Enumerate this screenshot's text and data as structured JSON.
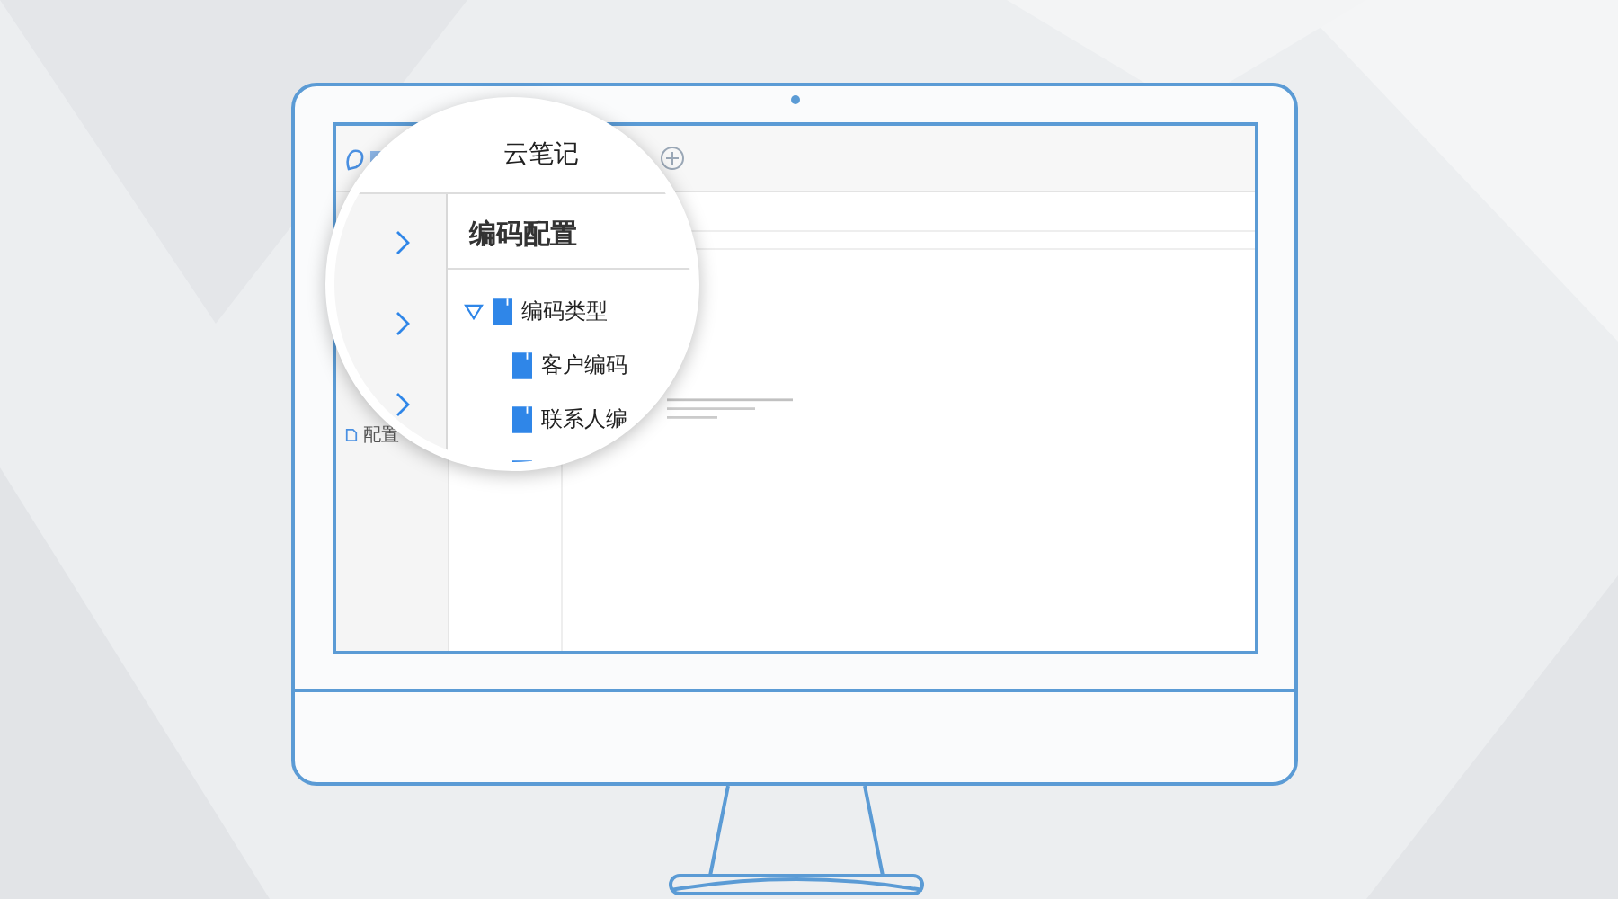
{
  "app_title": "云笔记",
  "sidebar": {
    "items": [
      {
        "label": "配置"
      }
    ]
  },
  "panel_title": "编码配置",
  "tree": [
    {
      "label": "编码类型",
      "expanded": true,
      "children": [
        {
          "label": "客户编码"
        },
        {
          "label": "联系人编"
        }
      ]
    }
  ]
}
